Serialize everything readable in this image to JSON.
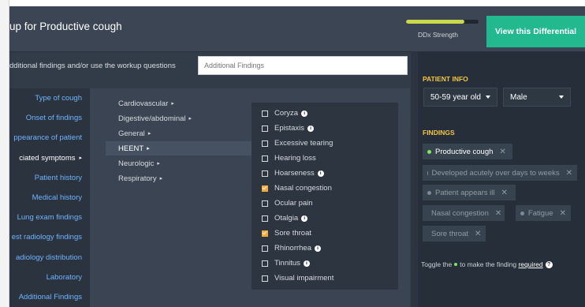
{
  "header": {
    "title": "up for Productive cough",
    "strength_label": "DDx Strength",
    "strength_level": 0.8,
    "view_button": "View this Differential"
  },
  "main": {
    "instruction": "dditional findings and/or use the workup questions",
    "search_placeholder": "Additional Findings",
    "categories": [
      {
        "label": "Type of cough"
      },
      {
        "label": "Onset of findings"
      },
      {
        "label": "ppearance of patient"
      },
      {
        "label": "ciated symptoms",
        "arrow": "▸"
      },
      {
        "label": "Patient history"
      },
      {
        "label": "Medical history"
      },
      {
        "label": "Lung exam findings"
      },
      {
        "label": "est radiology findings"
      },
      {
        "label": "adiology distribution"
      },
      {
        "label": "Laboratory"
      },
      {
        "label": "Additional Findings"
      }
    ],
    "systems": [
      {
        "label": "Cardiovascular",
        "caret": "▸"
      },
      {
        "label": "Digestive/abdominal",
        "caret": "▸"
      },
      {
        "label": "General",
        "caret": "▸"
      },
      {
        "label": "HEENT",
        "caret": "▸"
      },
      {
        "label": "Neurologic",
        "caret": "▸"
      },
      {
        "label": "Respiratory",
        "caret": "▸"
      }
    ],
    "symptoms": [
      {
        "label": "Coryza",
        "info": "i"
      },
      {
        "label": "Epistaxis",
        "info": "i"
      },
      {
        "label": "Excessive tearing"
      },
      {
        "label": "Hearing loss"
      },
      {
        "label": "Hoarseness",
        "info": "i"
      },
      {
        "label": "Nasal congestion",
        "checked": true
      },
      {
        "label": "Ocular pain"
      },
      {
        "label": "Otalgia",
        "info": "i"
      },
      {
        "label": "Sore throat",
        "checked": true
      },
      {
        "label": "Rhinorrhea",
        "info": "i"
      },
      {
        "label": "Tinnitus",
        "info": "i"
      },
      {
        "label": "Visual impairment"
      }
    ]
  },
  "right": {
    "patient_info_label": "PATIENT INFO",
    "age": "50-59 year old",
    "sex": "Male",
    "findings_label": "FINDINGS",
    "findings": [
      {
        "label": "Productive cough",
        "active": true,
        "x": "✕"
      },
      {
        "label": "Developed acutely over days to weeks",
        "x": "✕"
      },
      {
        "label": "Patient appears ill",
        "x": "✕"
      },
      {
        "label": "Nasal congestion",
        "x": "✕"
      },
      {
        "label": "Fatigue",
        "x": "✕"
      },
      {
        "label": "Sore throat",
        "x": "✕"
      }
    ],
    "toggle_prefix": "Toggle the",
    "toggle_middle": "to make the finding",
    "toggle_link": "required",
    "help_glyph": "?"
  },
  "colors": {
    "accent_green": "#22b98f",
    "link_blue": "#6fb4ff",
    "section_yellow": "#f4c542",
    "check_orange": "#f4a93b"
  }
}
